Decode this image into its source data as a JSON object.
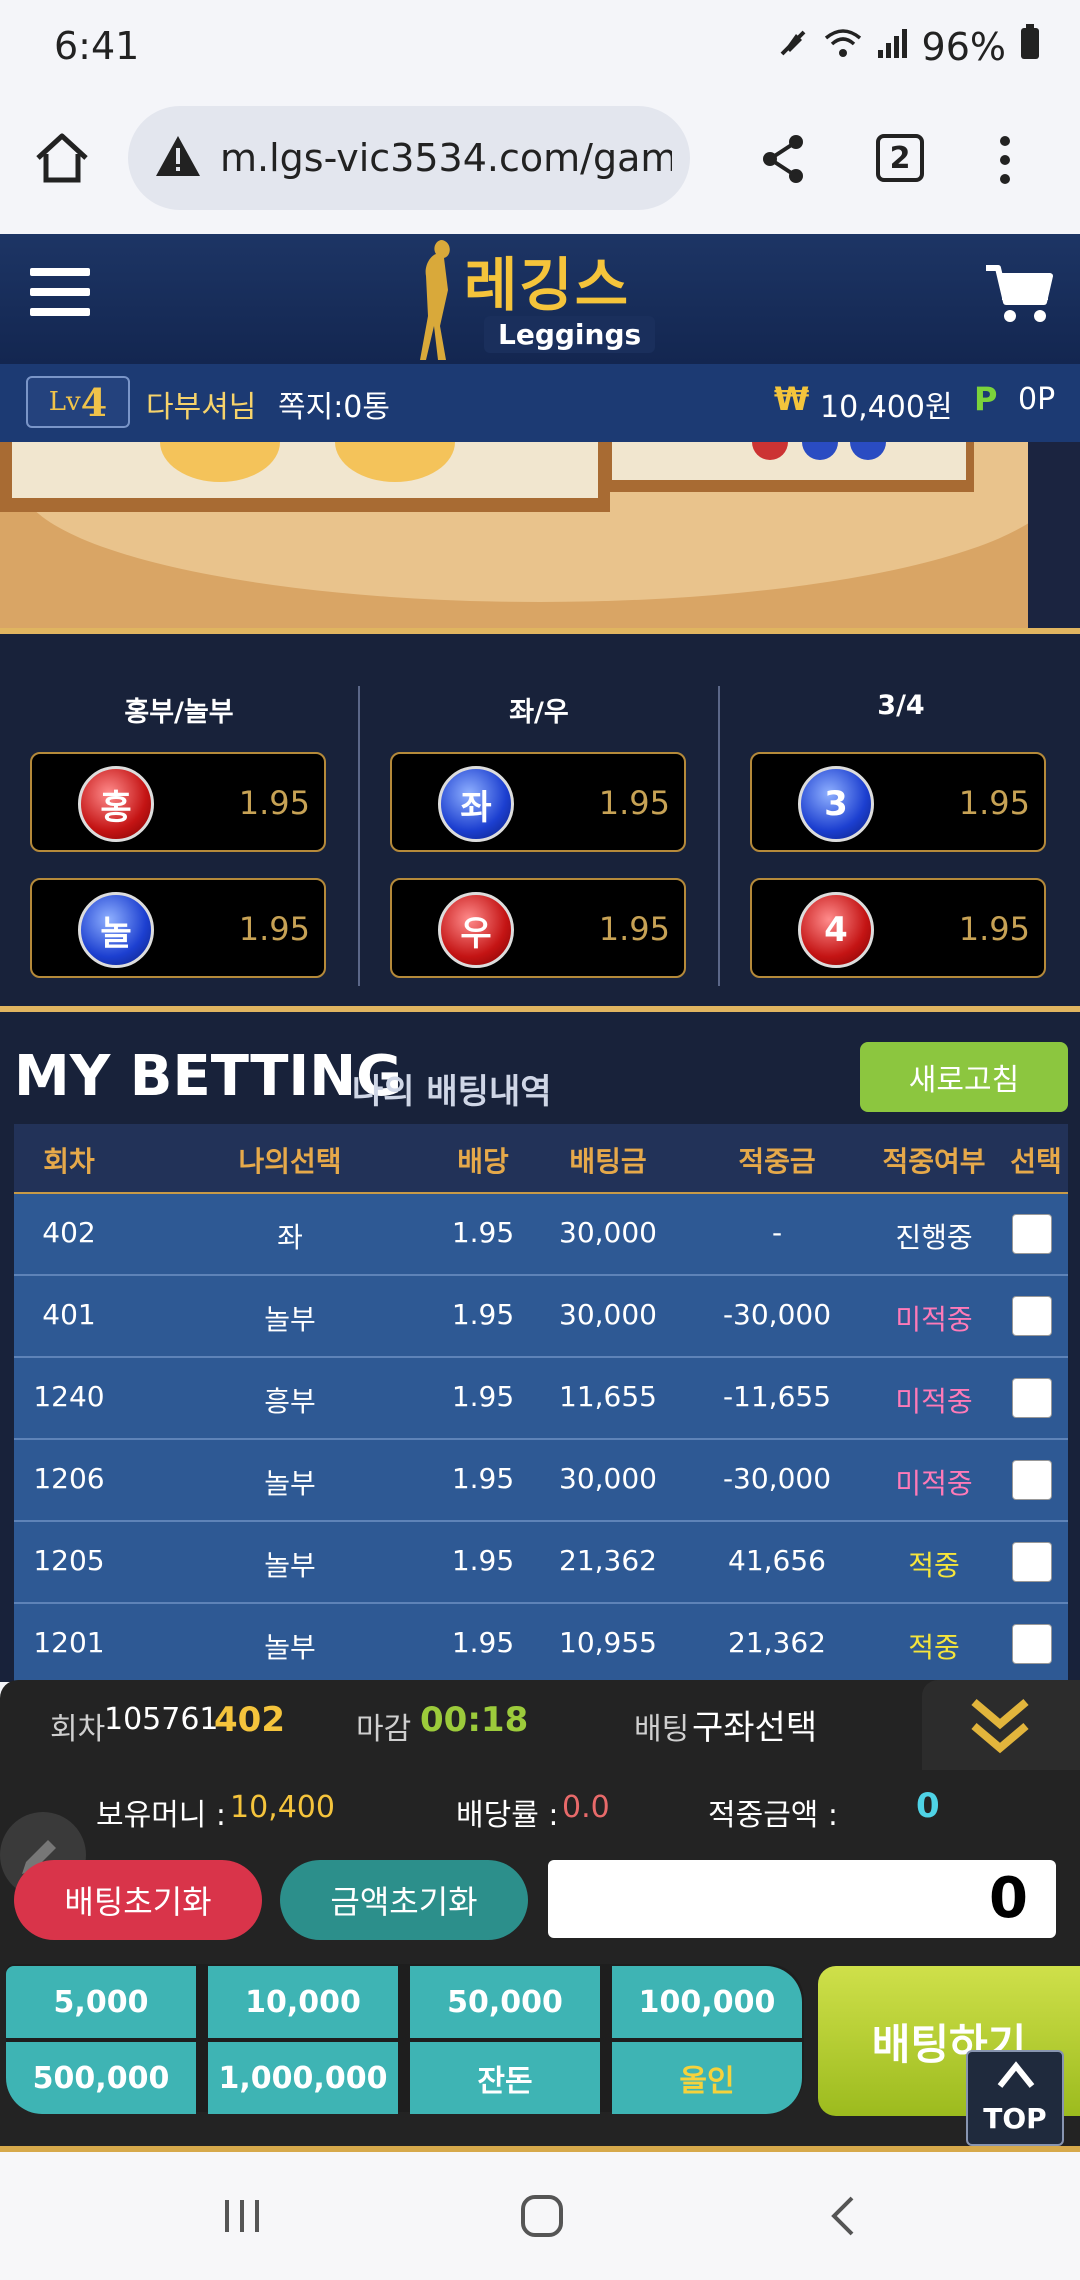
{
  "status": {
    "time": "6:41",
    "battery": "96%"
  },
  "browser": {
    "url": "m.lgs-vic3534.com/gam",
    "tabs": "2"
  },
  "header": {
    "logo_ko": "레깅스",
    "logo_en": "Leggings"
  },
  "user": {
    "level": "Lv4",
    "level_prefix": "Lv",
    "level_num": "4",
    "name": "다부셔님",
    "messages": "쪽지:0통",
    "money_symbol": "₩",
    "money": "10,400원",
    "point_symbol": "P",
    "points": "0P"
  },
  "odds": {
    "columns": [
      {
        "title": "홍부/놀부",
        "options": [
          {
            "ball": "홍",
            "color": "red",
            "odd": "1.95"
          },
          {
            "ball": "놀",
            "color": "blue",
            "odd": "1.95"
          }
        ]
      },
      {
        "title": "좌/우",
        "options": [
          {
            "ball": "좌",
            "color": "blue",
            "odd": "1.95"
          },
          {
            "ball": "우",
            "color": "red",
            "odd": "1.95"
          }
        ]
      },
      {
        "title": "3/4",
        "options": [
          {
            "ball": "3",
            "color": "blue",
            "odd": "1.95"
          },
          {
            "ball": "4",
            "color": "red",
            "odd": "1.95"
          }
        ]
      }
    ]
  },
  "my_betting": {
    "title": "MY BETTING",
    "subtitle": "나의 배팅내역",
    "refresh_label": "새로고침",
    "headers": [
      "회차",
      "나의선택",
      "배당",
      "배팅금",
      "적중금",
      "적중여부",
      "선택"
    ],
    "rows": [
      {
        "round": "402",
        "choice": "좌",
        "odds": "1.95",
        "bet": "30,000",
        "win": "-",
        "result": "진행중",
        "status": "pending"
      },
      {
        "round": "401",
        "choice": "놀부",
        "odds": "1.95",
        "bet": "30,000",
        "win": "-30,000",
        "result": "미적중",
        "status": "lose"
      },
      {
        "round": "1240",
        "choice": "흥부",
        "odds": "1.95",
        "bet": "11,655",
        "win": "-11,655",
        "result": "미적중",
        "status": "lose"
      },
      {
        "round": "1206",
        "choice": "놀부",
        "odds": "1.95",
        "bet": "30,000",
        "win": "-30,000",
        "result": "미적중",
        "status": "lose"
      },
      {
        "round": "1205",
        "choice": "놀부",
        "odds": "1.95",
        "bet": "21,362",
        "win": "41,656",
        "result": "적중",
        "status": "win"
      },
      {
        "round": "1201",
        "choice": "놀부",
        "odds": "1.95",
        "bet": "10,955",
        "win": "21,362",
        "result": "적중",
        "status": "win"
      }
    ]
  },
  "bet_panel": {
    "round_label": "회차",
    "round_id": "105761",
    "round_num": "402",
    "deadline_label": "마감",
    "deadline": "00:18",
    "bet_label": "배팅",
    "bet_choice": "구좌선택",
    "balance_label": "보유머니 :",
    "balance": "10,400",
    "rate_label": "배당률 :",
    "rate": "0.0",
    "win_label": "적중금액 :",
    "win_amount": "0",
    "reset_bet": "배팅초기화",
    "reset_amount": "금액초기화",
    "amount_value": "0",
    "amounts": [
      "5,000",
      "10,000",
      "50,000",
      "100,000",
      "500,000",
      "1,000,000",
      "잔돈",
      "올인"
    ],
    "submit": "배팅하기",
    "top": "TOP"
  }
}
